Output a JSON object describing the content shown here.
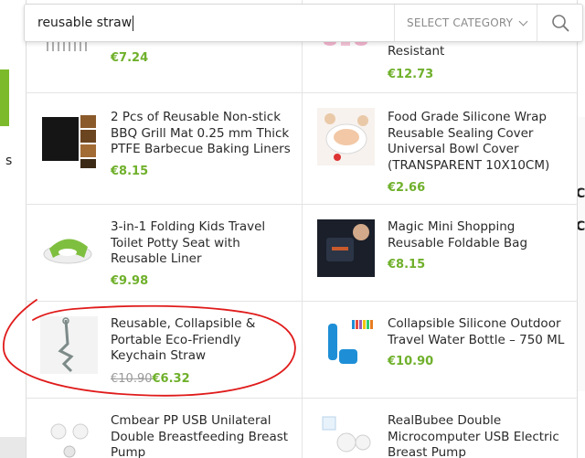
{
  "search": {
    "query": "reusable straw",
    "category_label": "SELECT CATEGORY"
  },
  "background": {
    "fragment_left": "s",
    "fragment_right_1": "C",
    "fragment_right_2": "C"
  },
  "products": [
    {
      "title": "",
      "price": "€7.24"
    },
    {
      "title": "Resistant",
      "price": "€12.73"
    },
    {
      "title": "2 Pcs of Reusable Non-stick BBQ Grill Mat 0.25 mm Thick PTFE Barbecue Baking Liners",
      "price": "€8.15"
    },
    {
      "title": "Food Grade Silicone Wrap Reusable Sealing Cover Universal Bowl Cover (TRANSPARENT 10X10CM)",
      "price": "€2.66"
    },
    {
      "title": "3-in-1 Folding Kids Travel Toilet Potty Seat with Reusable Liner",
      "price": "€9.98"
    },
    {
      "title": "Magic Mini Shopping Reusable Foldable Bag",
      "price": "€8.15"
    },
    {
      "title": "Reusable, Collapsible & Portable Eco-Friendly Keychain Straw",
      "old_price": "€10.90",
      "price": "€6.32"
    },
    {
      "title": "Collapsible Silicone Outdoor Travel Water Bottle – 750 ML",
      "price": "€10.90"
    },
    {
      "title": "Cmbear PP USB Unilateral Double Breastfeeding Breast Pump",
      "price": ""
    },
    {
      "title": "RealBubee Double Microcomputer USB Electric Breast Pump",
      "price": ""
    }
  ],
  "colors": {
    "price_green": "#6fb02b",
    "annotation_red": "#e01b1b"
  }
}
